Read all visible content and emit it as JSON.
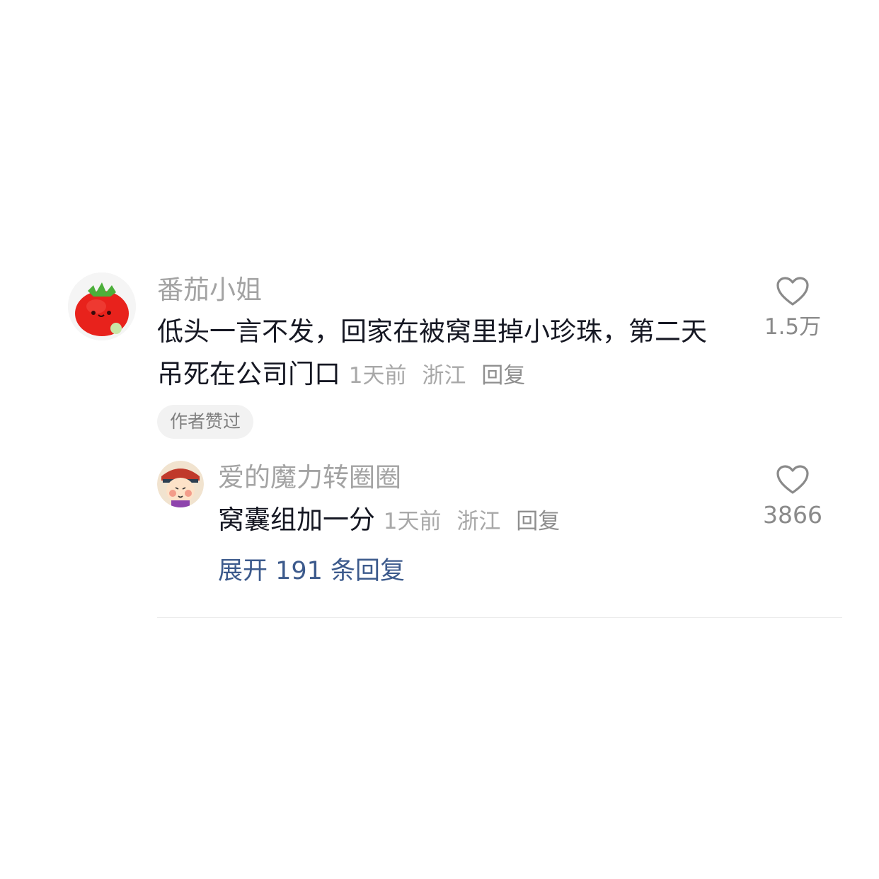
{
  "comment": {
    "username": "番茄小姐",
    "avatar_icon": "tomato-avatar-icon",
    "text_line1": "低头一言不发，回家在被窝里掉小珍珠，第二天",
    "text_line2": "吊死在公司门口",
    "time": "1天前",
    "location": "浙江",
    "reply_label": "回复",
    "likes": "1.5万",
    "author_badge": "作者赞过"
  },
  "reply": {
    "username": "爱的魔力转圈圈",
    "avatar_icon": "cartoon-face-avatar-icon",
    "text": "窝囊组加一分",
    "time": "1天前",
    "location": "浙江",
    "reply_label": "回复",
    "likes": "3866"
  },
  "expand_label": "展开 191 条回复",
  "colors": {
    "link_blue": "#3c5a8c",
    "username_gray": "#a3a3a3",
    "text_dark": "#161823"
  }
}
